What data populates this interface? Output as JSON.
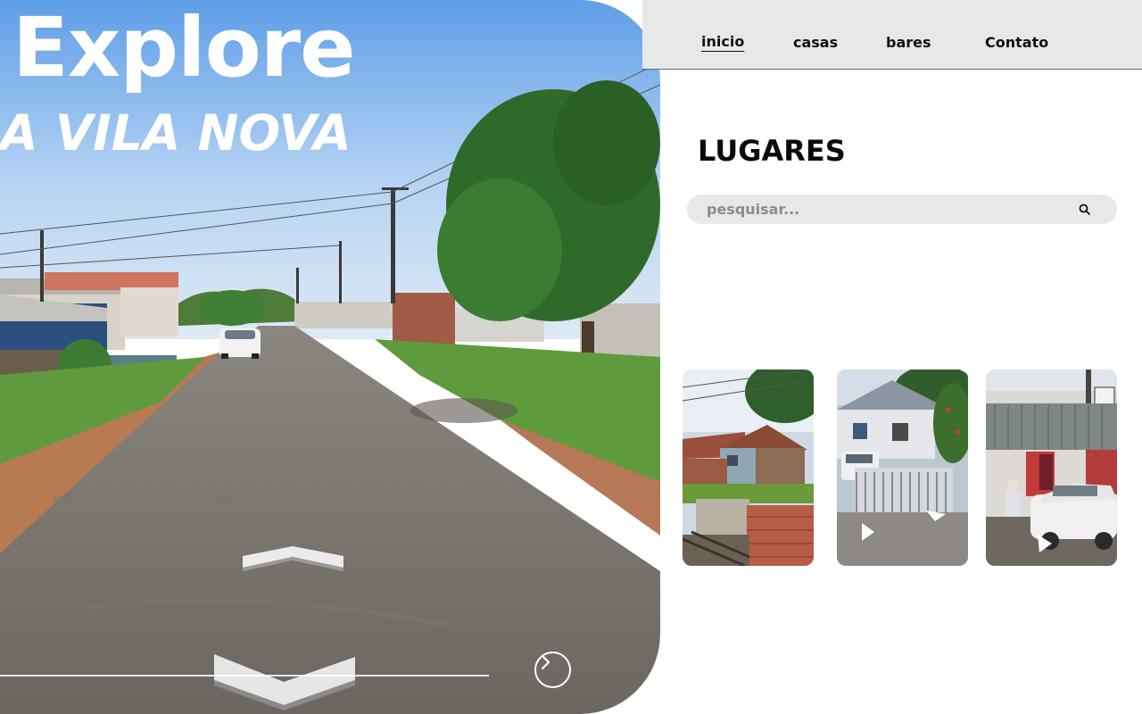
{
  "hero": {
    "title": "Explore",
    "subtitle": "A VILA NOVA"
  },
  "nav": {
    "items": [
      {
        "label": "inicio",
        "active": true
      },
      {
        "label": "casas"
      },
      {
        "label": "bares"
      },
      {
        "label": "Contato"
      }
    ]
  },
  "main": {
    "title": "LUGARES",
    "search": {
      "placeholder": "pesquisar...",
      "icon": "search-icon"
    },
    "thumbnails": [
      {
        "name": "place-thumbnail-1"
      },
      {
        "name": "place-thumbnail-2"
      },
      {
        "name": "place-thumbnail-3"
      }
    ]
  },
  "icons": {
    "forward": "chevron-right-circle-icon",
    "nav_up": "street-view-arrow-up-icon",
    "nav_down": "street-view-arrow-down-icon"
  },
  "colors": {
    "nav_bg": "#e8e8e8",
    "search_bg": "#e8e8e8",
    "text_dark": "#111111",
    "hero_text": "#ffffff"
  }
}
